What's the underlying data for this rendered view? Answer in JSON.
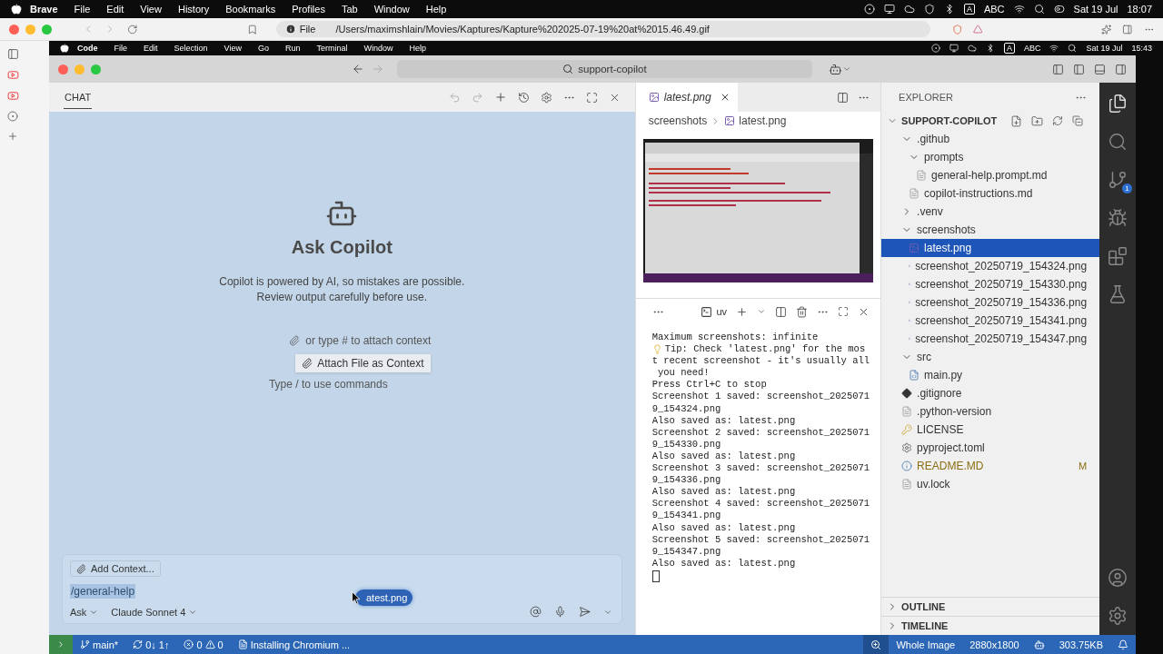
{
  "macos_menu_bar": {
    "app": "Brave",
    "menus": [
      "File",
      "Edit",
      "View",
      "History",
      "Bookmarks",
      "Profiles",
      "Tab",
      "Window",
      "Help"
    ],
    "input_source": "A",
    "input_name": "ABC",
    "date": "Sat 19 Jul",
    "time": "18:07"
  },
  "browser": {
    "url_scheme": "File",
    "url": "/Users/maximshlain/Movies/Kaptures/Kapture%202025-07-19%20at%2015.46.49.gif"
  },
  "inner_menu_bar": {
    "app": "Code",
    "menus": [
      "File",
      "Edit",
      "Selection",
      "View",
      "Go",
      "Run",
      "Terminal",
      "Window",
      "Help"
    ],
    "input_source": "A",
    "input_name": "ABC",
    "date": "Sat 19 Jul",
    "time": "15:43"
  },
  "vscode": {
    "search": "support-copilot",
    "chat": {
      "tab": "CHAT",
      "title": "Ask Copilot",
      "description": [
        "Copilot is powered by AI, so mistakes are possible.",
        "Review output carefully before use."
      ],
      "hints": [
        "or type # to attach context",
        "Type / to use commands"
      ],
      "tooltip": "Attach File as Context",
      "add_context": "Add Context...",
      "input_value": "/general-help",
      "drag_chip": "atest.png",
      "mode": "Ask",
      "model": "Claude Sonnet 4"
    },
    "editor": {
      "tab": {
        "label": "latest.png",
        "preview": true
      },
      "breadcrumb": [
        "screenshots",
        "latest.png"
      ]
    },
    "terminal": {
      "shell": "uv",
      "cursor": true,
      "lines": [
        {
          "kind": "text",
          "text": "Maximum screenshots: infinite"
        },
        {
          "kind": "tip",
          "text": "Tip: Check 'latest.png' for the mos"
        },
        {
          "kind": "text",
          "text": "t recent screenshot - it's usually all"
        },
        {
          "kind": "text",
          "text": " you need!"
        },
        {
          "kind": "text",
          "text": "Press Ctrl+C to stop"
        },
        {
          "kind": "text",
          "text": "Screenshot 1 saved: screenshot_2025071"
        },
        {
          "kind": "text",
          "text": "9_154324.png"
        },
        {
          "kind": "text",
          "text": "Also saved as: latest.png"
        },
        {
          "kind": "text",
          "text": "Screenshot 2 saved: screenshot_2025071"
        },
        {
          "kind": "text",
          "text": "9_154330.png"
        },
        {
          "kind": "text",
          "text": "Also saved as: latest.png"
        },
        {
          "kind": "text",
          "text": "Screenshot 3 saved: screenshot_2025071"
        },
        {
          "kind": "text",
          "text": "9_154336.png"
        },
        {
          "kind": "text",
          "text": "Also saved as: latest.png"
        },
        {
          "kind": "text",
          "text": "Screenshot 4 saved: screenshot_2025071"
        },
        {
          "kind": "text",
          "text": "9_154341.png"
        },
        {
          "kind": "text",
          "text": "Also saved as: latest.png"
        },
        {
          "kind": "text",
          "text": "Screenshot 5 saved: screenshot_2025071"
        },
        {
          "kind": "text",
          "text": "9_154347.png"
        },
        {
          "kind": "text",
          "text": "Also saved as: latest.png"
        }
      ]
    },
    "explorer": {
      "title": "EXPLORER",
      "root": "SUPPORT-COPILOT",
      "tree": [
        {
          "name": ".github",
          "kind": "folder",
          "expanded": true,
          "selected": false,
          "modified": false,
          "children": [
            {
              "name": "prompts",
              "kind": "folder",
              "expanded": true,
              "selected": false,
              "modified": false,
              "children": [
                {
                  "name": "general-help.prompt.md",
                  "kind": "text",
                  "selected": false,
                  "modified": false
                }
              ]
            },
            {
              "name": "copilot-instructions.md",
              "kind": "text",
              "selected": false,
              "modified": false
            }
          ]
        },
        {
          "name": ".venv",
          "kind": "folder",
          "expanded": false,
          "selected": false,
          "modified": false
        },
        {
          "name": "screenshots",
          "kind": "folder",
          "expanded": true,
          "selected": false,
          "modified": false,
          "children": [
            {
              "name": "latest.png",
              "kind": "image",
              "selected": true,
              "modified": false
            },
            {
              "name": "screenshot_20250719_154324.png",
              "kind": "image",
              "selected": false,
              "modified": false
            },
            {
              "name": "screenshot_20250719_154330.png",
              "kind": "image",
              "selected": false,
              "modified": false
            },
            {
              "name": "screenshot_20250719_154336.png",
              "kind": "image",
              "selected": false,
              "modified": false
            },
            {
              "name": "screenshot_20250719_154341.png",
              "kind": "image",
              "selected": false,
              "modified": false
            },
            {
              "name": "screenshot_20250719_154347.png",
              "kind": "image",
              "selected": false,
              "modified": false
            }
          ]
        },
        {
          "name": "src",
          "kind": "folder",
          "expanded": true,
          "selected": false,
          "modified": false,
          "children": [
            {
              "name": "main.py",
              "kind": "python",
              "selected": false,
              "modified": false
            }
          ]
        },
        {
          "name": ".gitignore",
          "kind": "git",
          "selected": false,
          "modified": false
        },
        {
          "name": ".python-version",
          "kind": "text",
          "selected": false,
          "modified": false
        },
        {
          "name": "LICENSE",
          "kind": "license",
          "selected": false,
          "modified": false
        },
        {
          "name": "pyproject.toml",
          "kind": "config",
          "selected": false,
          "modified": false
        },
        {
          "name": "README.MD",
          "kind": "readme",
          "selected": false,
          "modified": true,
          "decoration": "M"
        },
        {
          "name": "uv.lock",
          "kind": "text",
          "selected": false,
          "modified": false
        }
      ],
      "sections": [
        {
          "label": "OUTLINE",
          "expanded": false
        },
        {
          "label": "TIMELINE",
          "expanded": false
        }
      ]
    },
    "activity_bar": {
      "source_control_badge": "1"
    },
    "status_bar": {
      "branch": "main*",
      "sync": "0↓ 1↑",
      "errors": "0",
      "warnings": "0",
      "task": "Installing Chromium ...",
      "zoom": "Whole Image",
      "dimensions": "2880x1800",
      "size": "303.75KB"
    }
  }
}
